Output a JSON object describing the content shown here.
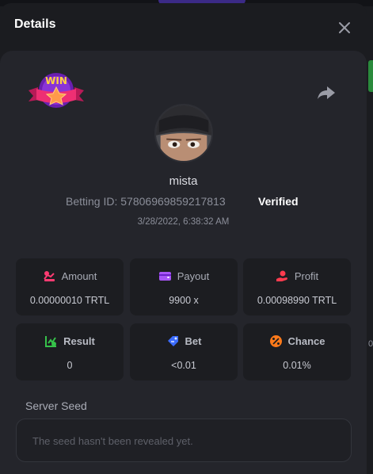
{
  "modal": {
    "title": "Details",
    "close_icon": "close-icon",
    "share_icon": "share-icon"
  },
  "badge": {
    "text": "WIN",
    "colors": {
      "ribbon": "#e82b6e",
      "circle": "#7d2fc4",
      "text": "#ffd23f"
    }
  },
  "player": {
    "username": "mista",
    "betting_id_label": "Betting ID:",
    "betting_id": "57806969859217813",
    "verified": "Verified",
    "date": "3/28/2022, 6:38:32 AM"
  },
  "stats": [
    {
      "label": "Amount",
      "value": "0.00000010 TRTL",
      "icon": "coins-icon",
      "color": "#ff3b72"
    },
    {
      "label": "Payout",
      "value": "9900 x",
      "icon": "wallet-icon",
      "color": "#a855f7"
    },
    {
      "label": "Profit",
      "value": "0.00098990 TRTL",
      "icon": "hand-coin-icon",
      "color": "#ff3b4e"
    },
    {
      "label": "Result",
      "value": "0",
      "icon": "chart-check-icon",
      "color": "#36c24a"
    },
    {
      "label": "Bet",
      "value": "<0.01",
      "icon": "tag-icon",
      "color": "#3b6cff"
    },
    {
      "label": "Chance",
      "value": "0.01%",
      "icon": "percent-icon",
      "color": "#ff7a1a"
    }
  ],
  "server_seed": {
    "label": "Server Seed",
    "placeholder": "The seed hasn't been revealed yet."
  },
  "edge": {
    "right_peek": "0"
  }
}
